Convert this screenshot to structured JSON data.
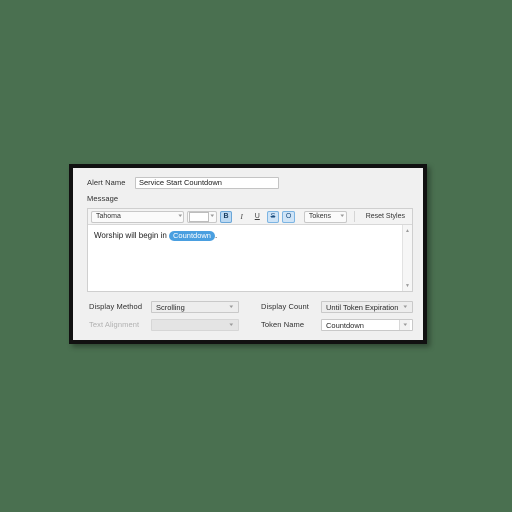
{
  "window": {
    "alert_name": {
      "label": "Alert Name",
      "value": "Service Start Countdown"
    },
    "message": {
      "label": "Message",
      "text_before": "Worship will begin in",
      "token_pill": "Countdown",
      "text_after": "."
    },
    "toolbar": {
      "font_family": "Tahoma",
      "font_color_caret": "⌵",
      "bold": "B",
      "italic": "I",
      "underline": "U",
      "strikethrough": "S",
      "outline": "O",
      "tokens": "Tokens",
      "reset_styles": "Reset Styles",
      "caret": "⌵"
    },
    "scrollbar": {
      "up_arrow": "▲",
      "down_arrow": "▼"
    },
    "options": {
      "display_method": {
        "label": "Display Method",
        "value": "Scrolling"
      },
      "text_alignment": {
        "label": "Text Alignment",
        "value": ""
      },
      "display_count": {
        "label": "Display Count",
        "value": "Until Token Expiration"
      },
      "token_name": {
        "label": "Token Name",
        "value": "Countdown"
      }
    }
  },
  "colors": {
    "page_background": "#4a7050",
    "token_pill": "#4a9fe0",
    "active_button": "#cfe4f7",
    "dialog_background": "#f0f0f0"
  }
}
